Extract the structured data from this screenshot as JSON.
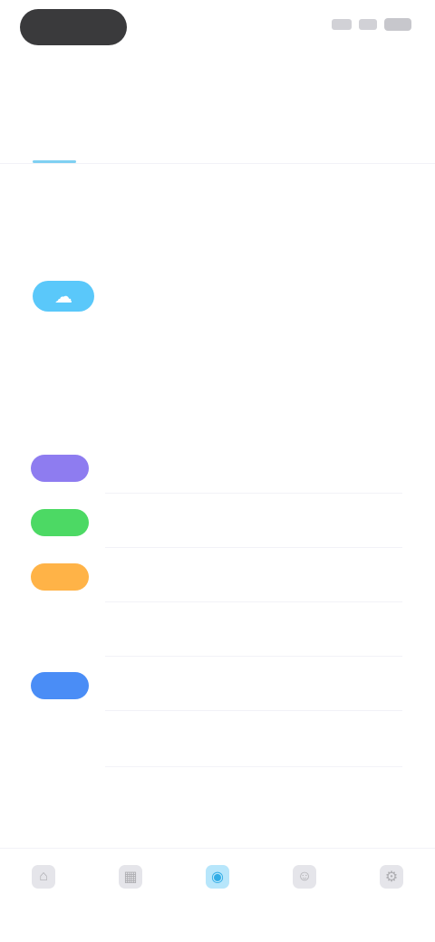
{
  "status_bar": {
    "time": ""
  },
  "header": {
    "title": ""
  },
  "tabs": [
    {
      "label": ""
    },
    {
      "label": ""
    },
    {
      "label": ""
    },
    {
      "label": ""
    }
  ],
  "section": {
    "title": "",
    "subtitle": ""
  },
  "featured": {
    "name": "",
    "description": "",
    "link": "",
    "icon": "cloud-icon",
    "color": "#5ac8fa"
  },
  "notice": {
    "title": "",
    "subtitle": ""
  },
  "list": [
    {
      "title": "",
      "description": "",
      "icon": "star-icon",
      "color": "#8e7cf0"
    },
    {
      "title": "",
      "description": "",
      "icon": "leaf-icon",
      "color": "#4cd964"
    },
    {
      "title": "",
      "description": "",
      "icon": "sun-icon",
      "color": "#ffb347"
    },
    {
      "title": "",
      "description": "",
      "icon": "none",
      "color": "#ffffff"
    },
    {
      "title": "",
      "description": "",
      "icon": "drop-icon",
      "color": "#4a8df6"
    },
    {
      "title": "",
      "description": "",
      "icon": "none",
      "color": "#ffffff"
    }
  ],
  "footer": {
    "note": "",
    "left_button": "",
    "right_button": ""
  },
  "tabbar": [
    {
      "label": "",
      "icon": "home-icon",
      "active": false
    },
    {
      "label": "",
      "icon": "grid-icon",
      "active": false
    },
    {
      "label": "",
      "icon": "bell-icon",
      "active": true
    },
    {
      "label": "",
      "icon": "user-icon",
      "active": false
    },
    {
      "label": "",
      "icon": "gear-icon",
      "active": false
    }
  ],
  "colors": {
    "accent": "#32ade6",
    "accent_light": "#5ac8fa",
    "text": "#3a3a3c",
    "muted": "#8e8e93"
  }
}
